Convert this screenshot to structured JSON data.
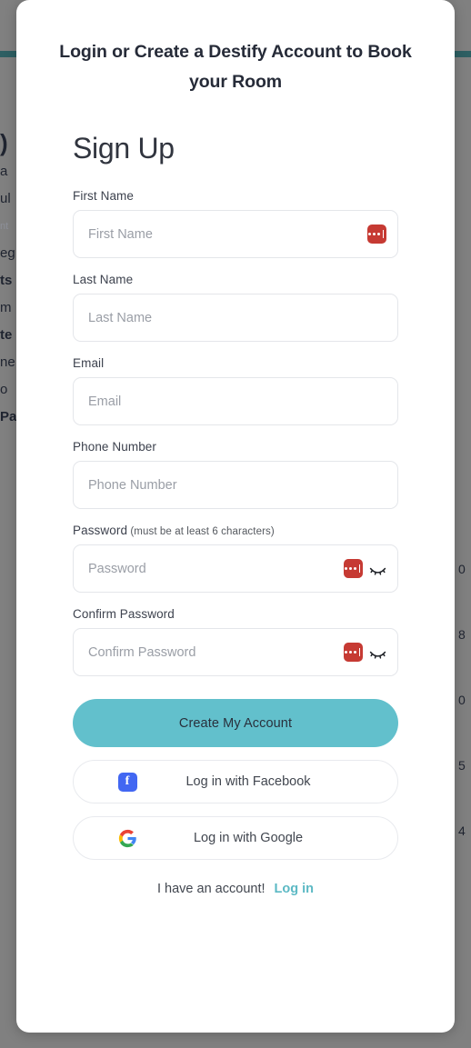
{
  "background": {
    "overlay_color": "#808080",
    "teal_bar_color": "#2d5f63",
    "left_fragments": [
      {
        "text": ")",
        "style": "big"
      },
      {
        "text": "a",
        "style": ""
      },
      {
        "text": "ul",
        "style": ""
      },
      {
        "text": "nt",
        "style": "faint"
      },
      {
        "text": "eg",
        "style": ""
      },
      {
        "text": "ts",
        "style": "bold"
      },
      {
        "text": "m",
        "style": ""
      },
      {
        "text": "te",
        "style": "bold"
      },
      {
        "text": "ne",
        "style": ""
      },
      {
        "text": "o",
        "style": ""
      },
      {
        "text": "Pa",
        "style": "bold"
      }
    ],
    "right_fragments": [
      "0",
      "8",
      "0",
      "5",
      "4"
    ]
  },
  "modal": {
    "title": "Login or Create a Destify Account to Book your Room",
    "heading": "Sign Up",
    "fields": [
      {
        "id": "first-name",
        "label": "First Name",
        "hint": "",
        "placeholder": "First Name",
        "value": "",
        "type": "text",
        "has_password_manager_icon": true,
        "has_eye_icon": false
      },
      {
        "id": "last-name",
        "label": "Last Name",
        "hint": "",
        "placeholder": "Last Name",
        "value": "",
        "type": "text",
        "has_password_manager_icon": false,
        "has_eye_icon": false
      },
      {
        "id": "email",
        "label": "Email",
        "hint": "",
        "placeholder": "Email",
        "value": "",
        "type": "email",
        "has_password_manager_icon": false,
        "has_eye_icon": false
      },
      {
        "id": "phone-number",
        "label": "Phone Number",
        "hint": "",
        "placeholder": "Phone Number",
        "value": "",
        "type": "tel",
        "has_password_manager_icon": false,
        "has_eye_icon": false
      },
      {
        "id": "password",
        "label": "Password",
        "hint": "(must be at least 6 characters)",
        "placeholder": "Password",
        "value": "",
        "type": "password",
        "has_password_manager_icon": true,
        "has_eye_icon": true
      },
      {
        "id": "confirm-password",
        "label": "Confirm Password",
        "hint": "",
        "placeholder": "Confirm Password",
        "value": "",
        "type": "password",
        "has_password_manager_icon": true,
        "has_eye_icon": true
      }
    ],
    "submit_label": "Create My Account",
    "submit_color": "#62c0cc",
    "social_buttons": [
      {
        "id": "facebook",
        "label": "Log in with Facebook",
        "icon": "facebook-icon",
        "color": "#4267f2"
      },
      {
        "id": "google",
        "label": "Log in with Google",
        "icon": "google-icon",
        "color": "#4285f4"
      }
    ],
    "footer": {
      "text": "I have an account!",
      "link_label": "Log in",
      "link_color": "#5cb9c4"
    }
  }
}
